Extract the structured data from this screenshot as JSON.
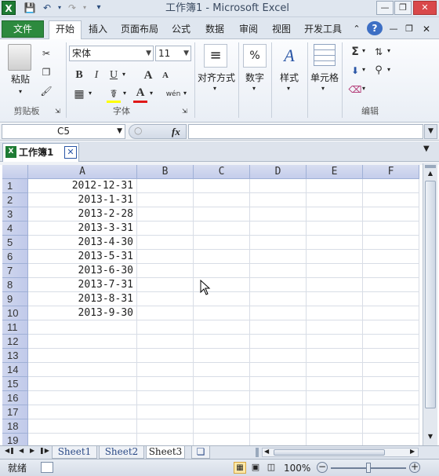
{
  "window": {
    "title": "工作簿1  -  Microsoft Excel",
    "app_icon": "X"
  },
  "ribbon_tabs": [
    "文件",
    "开始",
    "插入",
    "页面布局",
    "公式",
    "数据",
    "审阅",
    "视图",
    "开发工具"
  ],
  "clipboard": {
    "paste_label": "粘贴",
    "group_label": "剪贴板"
  },
  "font": {
    "name": "宋体",
    "size": "11",
    "group_label": "字体",
    "bold": "B",
    "italic": "I",
    "underline": "U",
    "grow": "A",
    "shrink": "A",
    "phonetic": "wén"
  },
  "alignment": {
    "label": "对齐方式"
  },
  "number": {
    "label": "数字",
    "symbol": "%"
  },
  "styles": {
    "label": "样式"
  },
  "cells_group": {
    "label": "单元格"
  },
  "editing": {
    "label": "编辑",
    "sum": "Σ"
  },
  "formula_bar": {
    "name_box": "C5",
    "fx": "fx",
    "value": ""
  },
  "workbook_tab": {
    "name": "工作簿1"
  },
  "grid": {
    "columns": [
      "A",
      "B",
      "C",
      "D",
      "E",
      "F"
    ],
    "rows": [
      "1",
      "2",
      "3",
      "4",
      "5",
      "6",
      "7",
      "8",
      "9",
      "10",
      "11",
      "12",
      "13",
      "14",
      "15",
      "16",
      "17",
      "18",
      "19"
    ],
    "col_a_values": [
      "2012-12-31",
      "2013-1-31",
      "2013-2-28",
      "2013-3-31",
      "2013-4-30",
      "2013-5-31",
      "2013-6-30",
      "2013-7-31",
      "2013-8-31",
      "2013-9-30"
    ]
  },
  "sheets": [
    "Sheet1",
    "Sheet2",
    "Sheet3"
  ],
  "active_sheet": "Sheet3",
  "status": {
    "ready": "就绪",
    "zoom": "100%"
  }
}
